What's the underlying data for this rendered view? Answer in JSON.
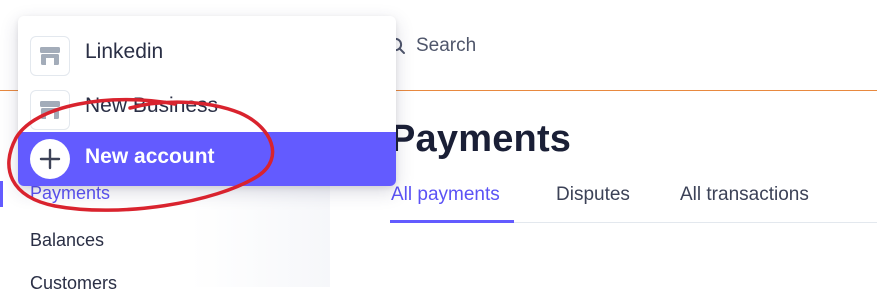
{
  "header": {
    "search_label": "Search"
  },
  "sidebar": {
    "items": [
      {
        "label": "Payments",
        "active": true
      },
      {
        "label": "Balances",
        "active": false
      },
      {
        "label": "Customers",
        "active": false
      }
    ]
  },
  "main": {
    "title": "Payments",
    "tabs": [
      {
        "label": "All payments",
        "active": true
      },
      {
        "label": "Disputes",
        "active": false
      },
      {
        "label": "All transactions",
        "active": false
      }
    ]
  },
  "account_dropdown": {
    "items": [
      {
        "label": "Linkedin",
        "icon": "store-icon"
      },
      {
        "label": "New Business",
        "icon": "store-icon"
      },
      {
        "label": "New account",
        "icon": "plus-icon",
        "highlighted": true
      }
    ]
  },
  "colors": {
    "accent": "#635bff",
    "annotation": "#d9232e",
    "header_rule": "#e8893f"
  }
}
